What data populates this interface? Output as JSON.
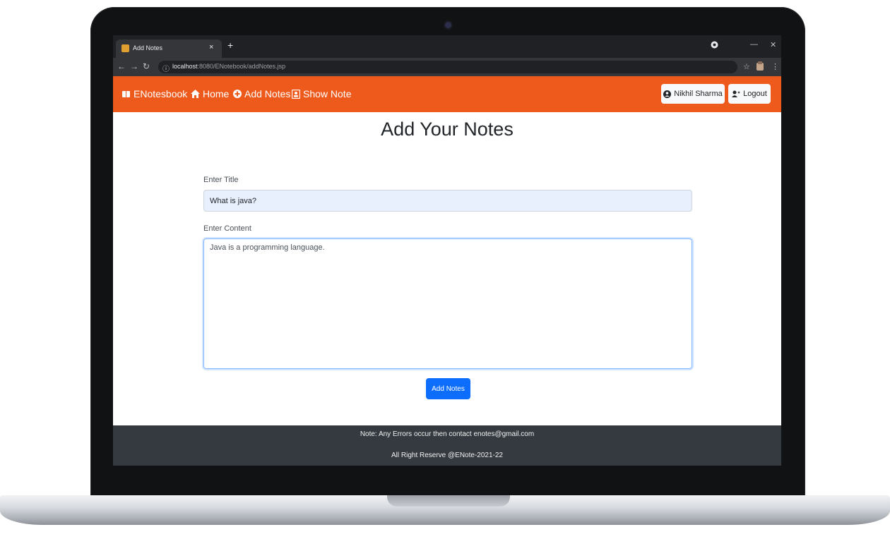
{
  "browser": {
    "tab_title": "Add Notes",
    "tab_close": "×",
    "new_tab": "+",
    "url_host": "localhost",
    "url_path": ":8080/ENotebook/addNotes.jsp",
    "window_controls": [
      "—",
      "✕"
    ]
  },
  "navbar": {
    "brand": "ENotesbook",
    "items": [
      {
        "label": "Home",
        "icon": "home-icon"
      },
      {
        "label": "Add Notes",
        "icon": "plus-circle-icon"
      },
      {
        "label": "Show Note",
        "icon": "address-book-icon"
      }
    ],
    "user_button": "Nikhil Sharma",
    "logout_button": "Logout"
  },
  "page": {
    "title": "Add Your Notes"
  },
  "form": {
    "title_label": "Enter Title",
    "title_value": "What is java?",
    "content_label": "Enter Content",
    "content_value": "Java is a programming language.",
    "submit_label": "Add Notes"
  },
  "footer": {
    "line1": "Note: Any Errors occur then contact enotes@gmail.com",
    "line2": "All Right Reserve @ENote-2021-22"
  },
  "colors": {
    "navbar": "#ee5a1c",
    "footer": "#343a40",
    "primary": "#0d6efd",
    "input_autofill": "#e8f0fe"
  }
}
